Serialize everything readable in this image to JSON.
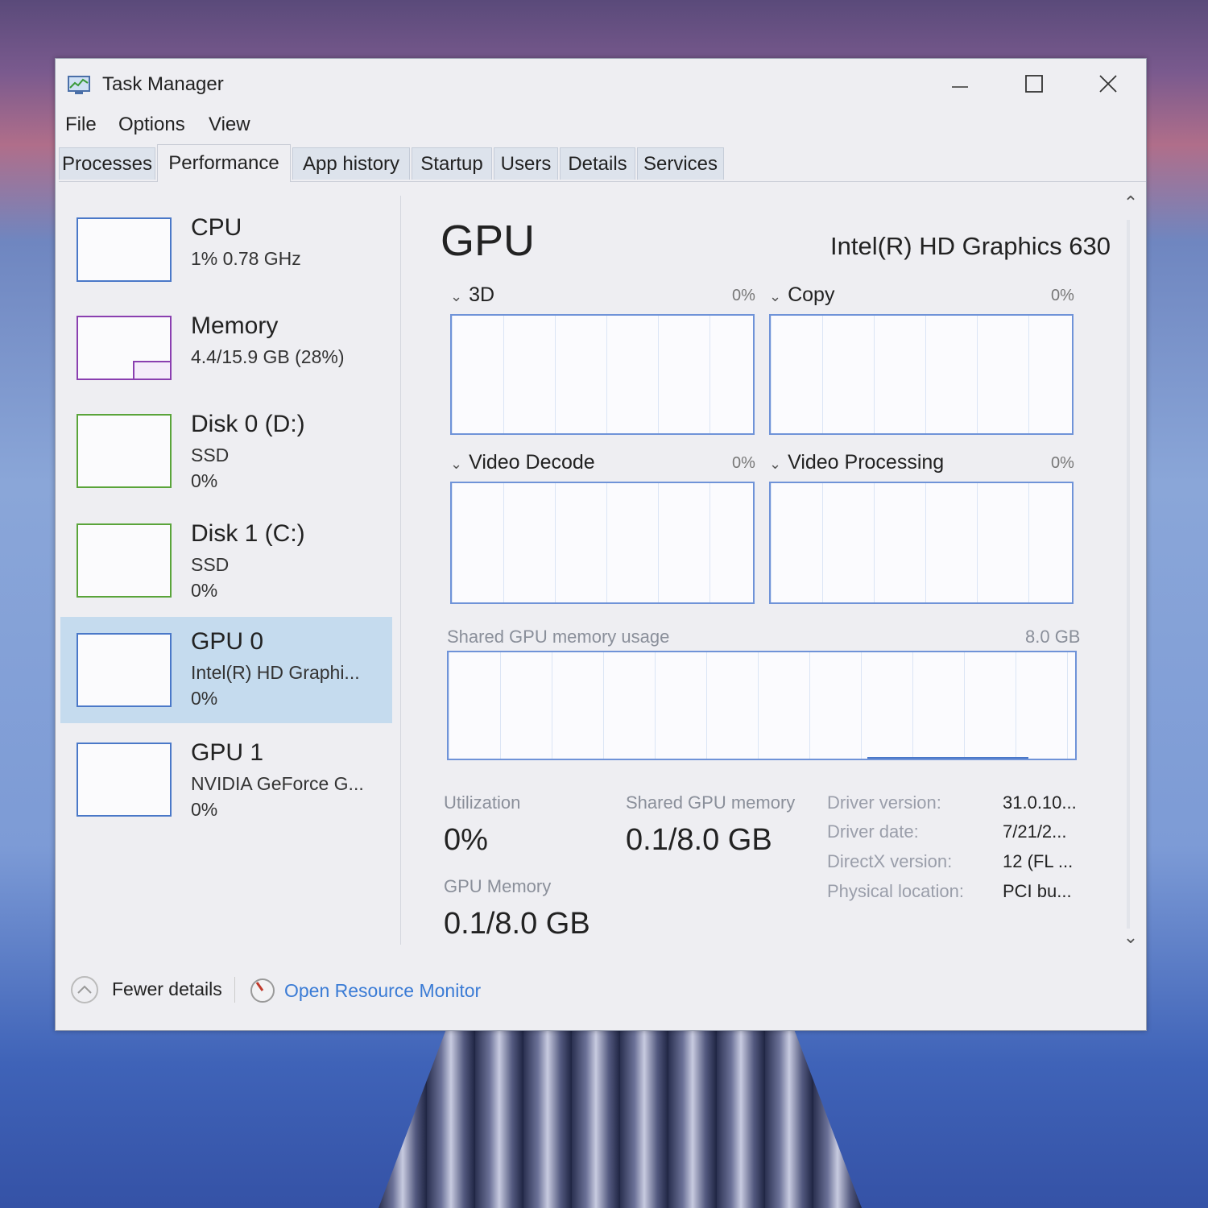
{
  "window": {
    "title": "Task Manager"
  },
  "menu": [
    "File",
    "Options",
    "View"
  ],
  "tabs": [
    "Processes",
    "Performance",
    "App history",
    "Startup",
    "Users",
    "Details",
    "Services"
  ],
  "active_tab": "Performance",
  "sidebar": {
    "items": [
      {
        "name": "CPU",
        "lines": [
          "1% 0.78 GHz"
        ],
        "color": "#4a78c8"
      },
      {
        "name": "Memory",
        "lines": [
          "4.4/15.9 GB (28%)"
        ],
        "color": "#8a3fb0"
      },
      {
        "name": "Disk 0 (D:)",
        "lines": [
          "SSD",
          "0%"
        ],
        "color": "#5aa43a"
      },
      {
        "name": "Disk 1 (C:)",
        "lines": [
          "SSD",
          "0%"
        ],
        "color": "#5aa43a"
      },
      {
        "name": "GPU 0",
        "lines": [
          "Intel(R) HD Graphi...",
          "0%"
        ],
        "color": "#4a78c8",
        "selected": true
      },
      {
        "name": "GPU 1",
        "lines": [
          "NVIDIA GeForce G...",
          "0%"
        ],
        "color": "#4a78c8"
      }
    ]
  },
  "main": {
    "title": "GPU",
    "model": "Intel(R) HD Graphics 630",
    "engines": [
      {
        "label": "3D",
        "pct": "0%"
      },
      {
        "label": "Copy",
        "pct": "0%"
      },
      {
        "label": "Video Decode",
        "pct": "0%"
      },
      {
        "label": "Video Processing",
        "pct": "0%"
      }
    ],
    "shared_memory_graph": {
      "label": "Shared GPU memory usage",
      "max": "8.0 GB"
    },
    "stats": {
      "utilization_label": "Utilization",
      "utilization_value": "0%",
      "shared_label": "Shared GPU memory",
      "shared_value": "0.1/8.0 GB",
      "gpu_memory_label": "GPU Memory",
      "gpu_memory_value": "0.1/8.0 GB"
    },
    "info": [
      {
        "label": "Driver version:",
        "value": "31.0.10..."
      },
      {
        "label": "Driver date:",
        "value": "7/21/2..."
      },
      {
        "label": "DirectX version:",
        "value": "12 (FL ..."
      },
      {
        "label": "Physical location:",
        "value": "PCI bu..."
      }
    ]
  },
  "footer": {
    "fewer_details": "Fewer details",
    "open_resource_monitor": "Open Resource Monitor"
  },
  "colors": {
    "accent": "#4a78c8",
    "link": "#3a7bd5",
    "selected": "#c5dbee"
  }
}
